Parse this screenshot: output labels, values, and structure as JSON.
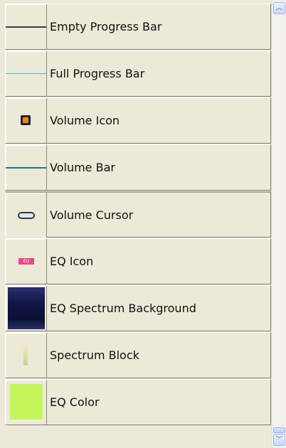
{
  "items": [
    {
      "label": "Empty Progress Bar",
      "icon": "dark-line-icon"
    },
    {
      "label": "Full Progress Bar",
      "icon": "cyan-line-icon"
    },
    {
      "label": "Volume Icon",
      "icon": "speaker-icon"
    },
    {
      "label": "Volume Bar",
      "icon": "teal-line-icon"
    },
    {
      "label": "Volume Cursor",
      "icon": "pill-cursor-icon"
    },
    {
      "label": "EQ Icon",
      "icon": "eq-badge-icon",
      "badge_text": "EQ"
    },
    {
      "label": "EQ Spectrum Background",
      "icon": "spectrum-gradient-icon"
    },
    {
      "label": "Spectrum Block",
      "icon": "spectrum-block-icon"
    },
    {
      "label": "EQ Color",
      "icon": "color-swatch-icon",
      "color": "#c2f55a"
    }
  ],
  "scrollbar": {
    "up_glyph": "︿",
    "down_glyph": "﹀"
  }
}
